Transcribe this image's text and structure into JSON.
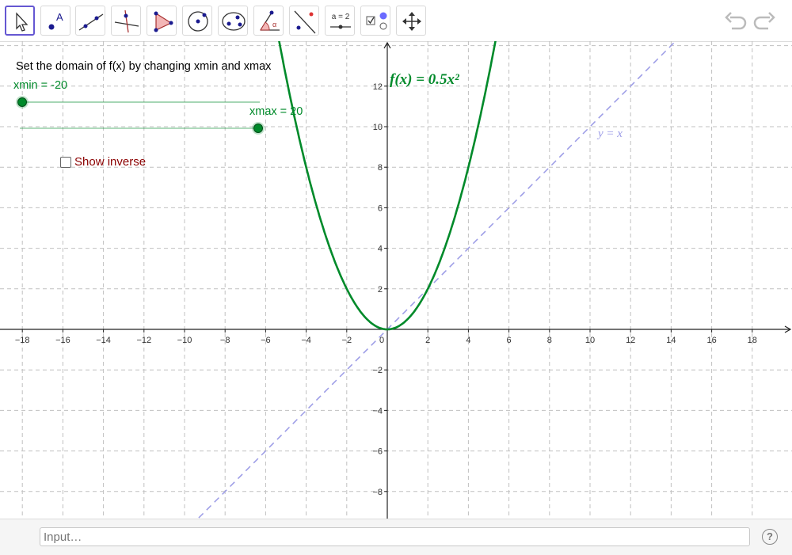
{
  "toolbar": {
    "tools": [
      {
        "name": "move-tool",
        "icon": "cursor-arrow-icon",
        "selected": true
      },
      {
        "name": "point-tool",
        "icon": "point-a-icon"
      },
      {
        "name": "line-tool",
        "icon": "line-through-points-icon"
      },
      {
        "name": "perpendicular-tool",
        "icon": "perpendicular-line-icon"
      },
      {
        "name": "polygon-tool",
        "icon": "polygon-icon"
      },
      {
        "name": "circle-tool",
        "icon": "circle-center-point-icon"
      },
      {
        "name": "conic-tool",
        "icon": "ellipse-icon"
      },
      {
        "name": "angle-tool",
        "icon": "angle-icon"
      },
      {
        "name": "reflect-tool",
        "icon": "reflect-about-line-icon"
      },
      {
        "name": "slider-tool",
        "icon": "slider-icon",
        "label": "a = 2"
      },
      {
        "name": "checkbox-tool",
        "icon": "checkbox-icon"
      },
      {
        "name": "move-graphics-tool",
        "icon": "move-arrows-icon"
      }
    ],
    "undo_icon": "undo-icon",
    "redo_icon": "redo-icon"
  },
  "canvas": {
    "instruction": "Set the domain of f(x) by changing xmin and xmax",
    "xmin_label": "xmin = -20",
    "xmax_label": "xmax = 20",
    "xmin_value": -20,
    "xmax_value": 20,
    "show_inverse_label": "Show inverse",
    "show_inverse_checked": false,
    "function_label": "f(x) = 0.5x²",
    "identity_label": "y = x",
    "colors": {
      "function": "#008a2a",
      "identity_line": "#9b9be6",
      "slider": "#008a2a",
      "checkbox_label": "#8b0000",
      "grid": "#c0c0c0",
      "selected_tool": "#6557d2"
    }
  },
  "graph": {
    "x_ticks": [
      "−18",
      "−16",
      "−14",
      "−12",
      "−10",
      "−8",
      "−6",
      "−4",
      "−2",
      "0",
      "2",
      "4",
      "6",
      "8",
      "10",
      "12",
      "14",
      "16",
      "18"
    ],
    "y_ticks": [
      "12",
      "10",
      "8",
      "6",
      "4",
      "2",
      "−2",
      "−4",
      "−6",
      "−8"
    ]
  },
  "input_bar": {
    "placeholder": "Input…",
    "help_icon": "help-icon",
    "help_symbol": "?"
  }
}
